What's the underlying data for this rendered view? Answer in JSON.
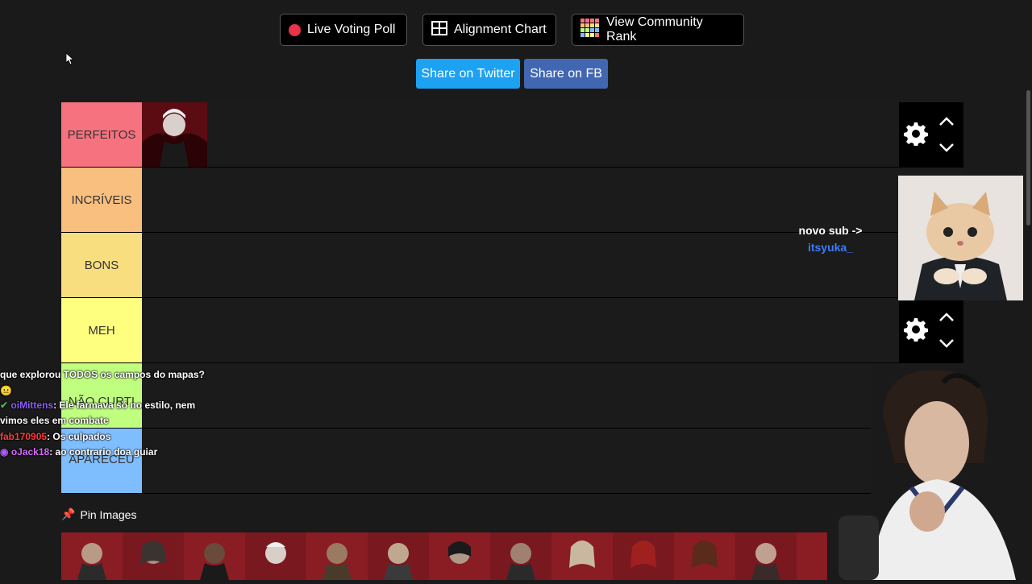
{
  "toolbar": {
    "live_poll": "Live Voting Poll",
    "alignment": "Alignment Chart",
    "community": "View Community Rank",
    "twitter": "Share on Twitter",
    "fb": "Share on FB"
  },
  "tiers": [
    {
      "label": "PERFEITOS",
      "color": "#f7727f"
    },
    {
      "label": "INCRÍVEIS",
      "color": "#f8bf7f"
    },
    {
      "label": "BONS",
      "color": "#f8de7f"
    },
    {
      "label": "MEH",
      "color": "#fefe7f"
    },
    {
      "label": "NÃO CURTI",
      "color": "#bffe7f"
    },
    {
      "label": "APARECEU",
      "color": "#7fbefe"
    }
  ],
  "overlay": {
    "sub_title": "novo sub ->",
    "sub_name": "itsyuka_"
  },
  "pin": {
    "label": "Pin Images"
  },
  "chat": [
    {
      "user": "",
      "text": "que explorou TODOS os campos do mapas?",
      "color": "#ffffff"
    },
    {
      "user": "oiMittens",
      "text": "Ele farmava só no estilo, nem vimos eles em combate",
      "color": "#8a5cf6"
    },
    {
      "user": "fab170905",
      "text": "Os culpados",
      "color": "#ff3b3b"
    },
    {
      "user": "oJack18",
      "text": "ao contrario doa guiar",
      "color": "#d56bff"
    }
  ],
  "colors": {
    "twitter": "#1da1f2",
    "facebook": "#4267b2",
    "live_dot": "#e8334a",
    "sub_name": "#3b7bff"
  }
}
